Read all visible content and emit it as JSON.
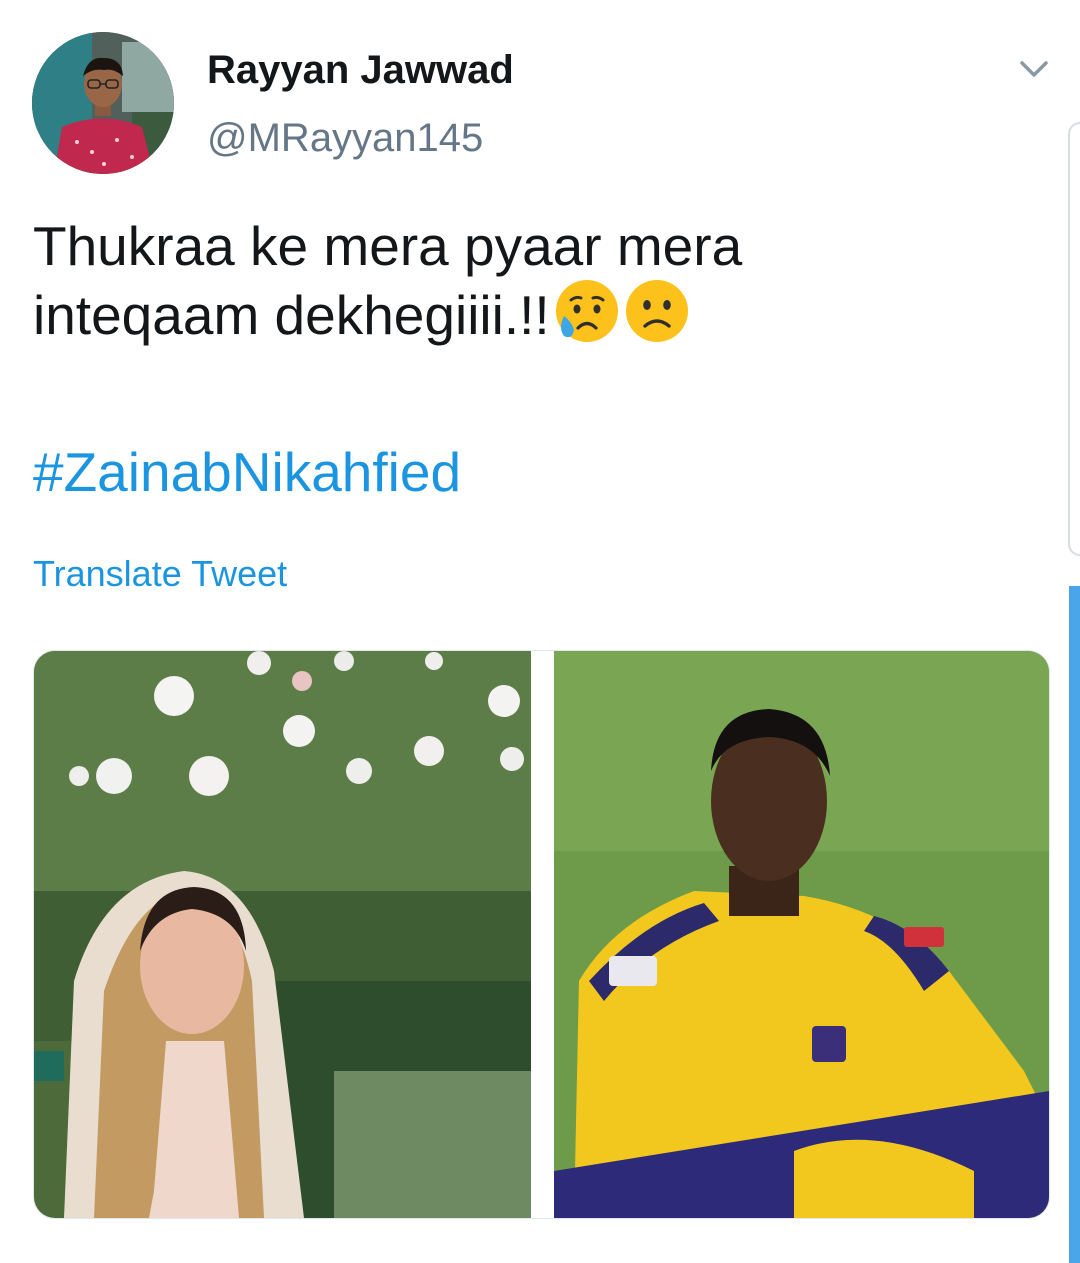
{
  "tweet": {
    "author": {
      "display_name": "Rayyan Jawwad",
      "handle": "@MRayyan145"
    },
    "text_lines": [
      "Thukraa ke mera pyaar mera",
      "inteqaam dekhegiiii.!!"
    ],
    "emojis": [
      "sad-relieved-face-icon",
      "slightly-frowning-face-icon"
    ],
    "hashtag": "#ZainabNikahfied",
    "translate_label": "Translate Tweet",
    "media": [
      "bride-photo",
      "cricketer-photo"
    ]
  },
  "colors": {
    "text": "#14171a",
    "secondary": "#657786",
    "link": "#1b95e0"
  }
}
